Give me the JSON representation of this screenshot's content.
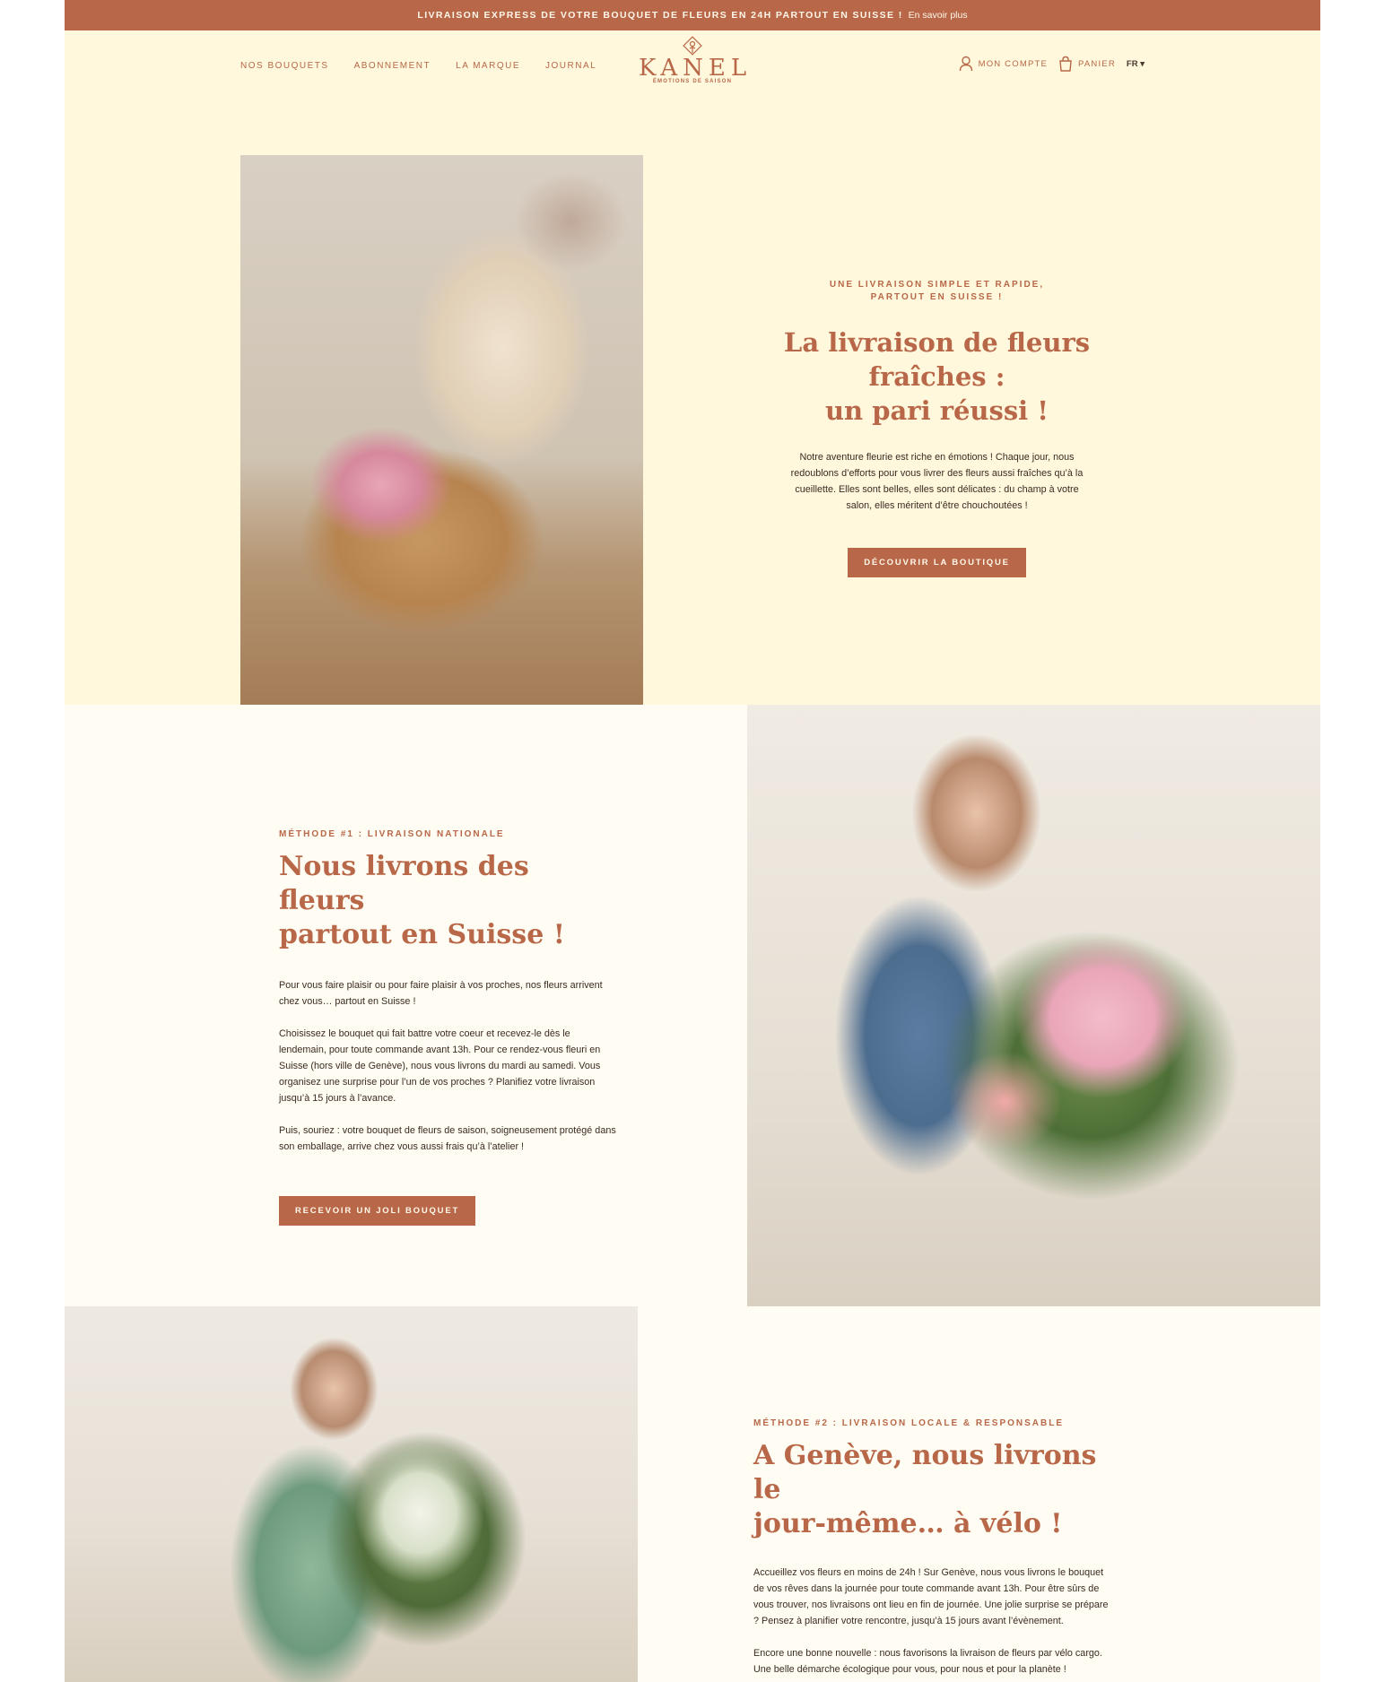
{
  "announcement": {
    "text": "LIVRAISON EXPRESS DE VOTRE BOUQUET DE FLEURS EN 24H PARTOUT EN SUISSE !",
    "link": "En savoir plus"
  },
  "nav": {
    "left": [
      "NOS BOUQUETS",
      "ABONNEMENT",
      "LA MARQUE",
      "JOURNAL"
    ],
    "account": "MON COMPTE",
    "cart": "PANIER",
    "lang": "FR"
  },
  "logo": {
    "name": "KANEL",
    "tagline": "ÉMOTIONS DE SAISON"
  },
  "hero": {
    "eyebrow": "UNE LIVRAISON SIMPLE ET RAPIDE, PARTOUT EN SUISSE !",
    "title_line1": "La livraison de fleurs fraîches :",
    "title_line2": "un pari réussi !",
    "body": "Notre aventure fleurie est riche en émotions ! Chaque jour, nous redoublons d’efforts pour vous livrer des fleurs aussi fraîches qu’à la cueillette. Elles sont belles, elles sont délicates : du champ à votre salon, elles méritent d’être chouchoutées !",
    "cta": "DÉCOUVRIR LA BOUTIQUE"
  },
  "method1": {
    "eyebrow": "MÉTHODE #1 : LIVRAISON NATIONALE",
    "title_line1": "Nous livrons des fleurs",
    "title_line2": "partout en Suisse !",
    "p1": "Pour vous faire plaisir ou pour faire plaisir à vos proches, nos fleurs arrivent chez vous… partout en Suisse !",
    "p2": "Choisissez le bouquet qui fait battre votre coeur et recevez-le dès le lendemain, pour toute commande avant 13h. Pour ce rendez-vous fleuri en Suisse (hors ville de Genève), nous vous livrons du mardi au samedi. Vous organisez une surprise pour l’un de vos proches ? Planifiez votre livraison jusqu’à 15 jours à l’avance.",
    "p3": "Puis, souriez : votre bouquet de fleurs de saison, soigneusement protégé dans son emballage, arrive chez vous aussi frais qu’à l’atelier !",
    "cta": "RECEVOIR UN JOLI BOUQUET"
  },
  "method2": {
    "eyebrow": "MÉTHODE #2 : LIVRAISON LOCALE & RESPONSABLE",
    "title_line1": "A Genève, nous livrons le",
    "title_line2": "jour-même… à vélo !",
    "p1": "Accueillez vos fleurs en moins de 24h ! Sur Genève, nous vous livrons le bouquet de vos rêves dans la journée pour toute commande avant 13h. Pour être sûrs de vous trouver, nos livraisons ont lieu en fin de journée. Une jolie surprise se prépare ? Pensez à planifier votre rencontre, jusqu’à 15 jours avant l’évènement.",
    "p2": "Encore une bonne nouvelle : nous favorisons la livraison de fleurs par vélo cargo. Une belle démarche écologique pour vous, pour nous et pour la planète !"
  },
  "colors": {
    "accent": "#b86848",
    "cream": "#fff8dc",
    "ivory": "#fffcf3"
  },
  "icons": [
    "user-icon",
    "bag-icon",
    "chevron-down-icon",
    "flower-emblem-icon"
  ]
}
